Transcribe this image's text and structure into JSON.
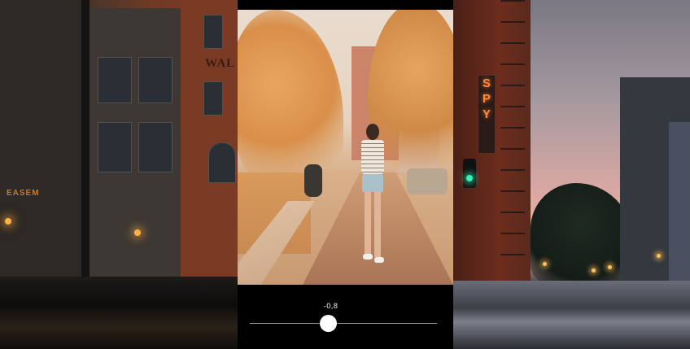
{
  "editor": {
    "adjustment_value": "-0,8",
    "slider": {
      "value": -0.8,
      "min": -10,
      "max": 10
    }
  },
  "background_signs": {
    "left_building": "WAL",
    "left_shop": "EASEM",
    "right_neon": [
      "S",
      "P",
      "Y"
    ]
  },
  "colors": {
    "slider_thumb": "#ffffff",
    "slider_track": "#9a9a9a",
    "panel_background": "#000000",
    "neon_sign": "#ff8a3c",
    "traffic_light_green": "#36f0b5"
  }
}
